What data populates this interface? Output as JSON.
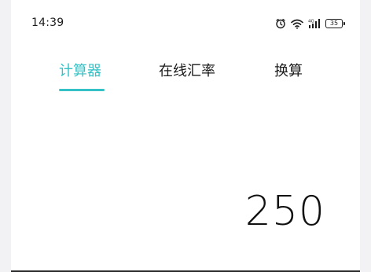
{
  "status_bar": {
    "time": "14:39",
    "icons": [
      "alarm-icon",
      "wifi-icon",
      "signal-4g-icon",
      "battery-icon"
    ],
    "network_label": "4G",
    "battery_level": "35"
  },
  "tabs": [
    {
      "label": "计算器",
      "active": true
    },
    {
      "label": "在线汇率",
      "active": false
    },
    {
      "label": "换算",
      "active": false
    }
  ],
  "calculator": {
    "display_value": "250"
  },
  "colors": {
    "accent": "#35c2c7",
    "text": "#1a1a1a",
    "background": "#ffffff"
  }
}
